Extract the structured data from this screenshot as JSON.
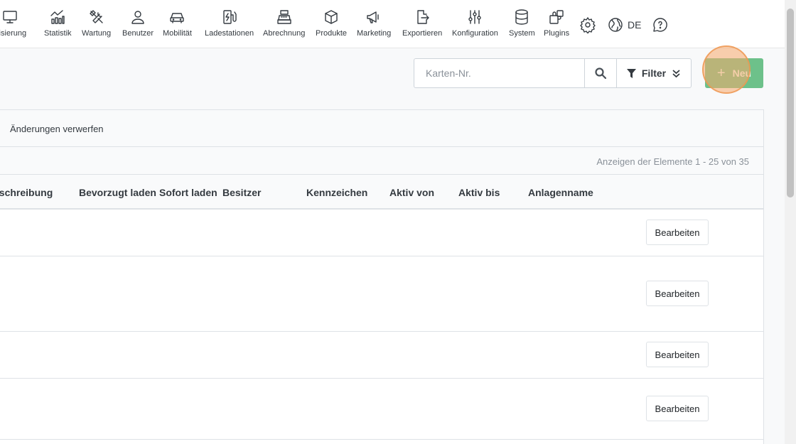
{
  "nav": {
    "items": [
      {
        "label": "alisierung",
        "icon": "monitor-icon"
      },
      {
        "label": "Statistik",
        "icon": "statistics-icon"
      },
      {
        "label": "Wartung",
        "icon": "tools-icon"
      },
      {
        "label": "Benutzer",
        "icon": "user-icon"
      },
      {
        "label": "Mobilität",
        "icon": "car-icon"
      },
      {
        "label": "Ladestationen",
        "icon": "charging-station-icon"
      },
      {
        "label": "Abrechnung",
        "icon": "cash-register-icon"
      },
      {
        "label": "Produkte",
        "icon": "box-icon"
      },
      {
        "label": "Marketing",
        "icon": "megaphone-icon"
      },
      {
        "label": "Exportieren",
        "icon": "export-icon"
      },
      {
        "label": "Konfiguration",
        "icon": "sliders-icon"
      },
      {
        "label": "System",
        "icon": "database-icon"
      },
      {
        "label": "Plugins",
        "icon": "puzzle-icon"
      }
    ],
    "language": "DE"
  },
  "toolbar": {
    "search_placeholder": "Karten-Nr.",
    "filter_label": "Filter",
    "new_label": "Neu"
  },
  "card": {
    "discard_label": "Änderungen verwerfen",
    "pager_text": "Anzeigen der Elemente 1 - 25 von 35"
  },
  "table": {
    "columns": [
      "eschreibung",
      "Bevorzugt laden",
      "Sofort laden",
      "Besitzer",
      "Kennzeichen",
      "Aktiv von",
      "Aktiv bis",
      "Anlagenname"
    ],
    "edit_label": "Bearbeiten"
  },
  "colors": {
    "accent_green": "#6dc18a",
    "click_highlight": "#f8aa6c"
  }
}
